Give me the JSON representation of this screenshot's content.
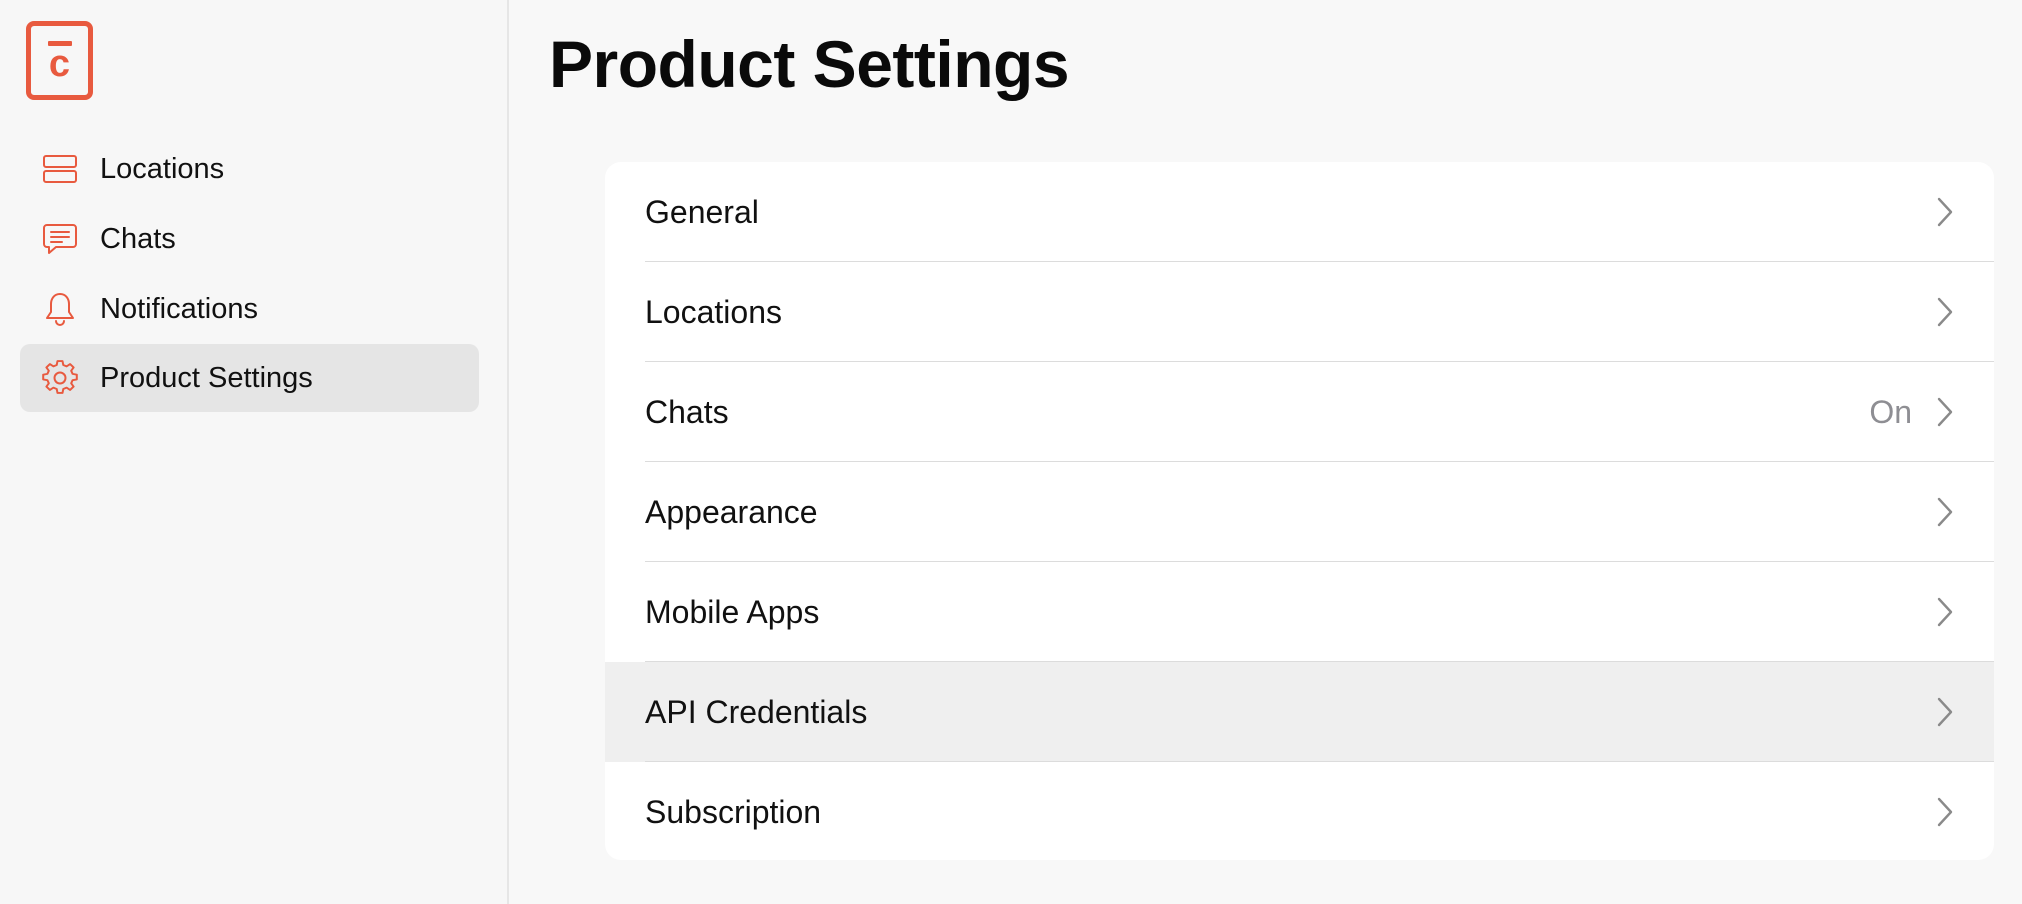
{
  "app": {
    "logo_letter": "c"
  },
  "sidebar": {
    "items": [
      {
        "label": "Locations",
        "icon": "locations-icon"
      },
      {
        "label": "Chats",
        "icon": "chat-bubble-icon"
      },
      {
        "label": "Notifications",
        "icon": "bell-icon"
      },
      {
        "label": "Product Settings",
        "icon": "gear-icon",
        "active": true
      }
    ]
  },
  "main": {
    "title": "Product Settings",
    "settings": [
      {
        "label": "General",
        "value": ""
      },
      {
        "label": "Locations",
        "value": ""
      },
      {
        "label": "Chats",
        "value": "On"
      },
      {
        "label": "Appearance",
        "value": ""
      },
      {
        "label": "Mobile Apps",
        "value": ""
      },
      {
        "label": "API Credentials",
        "value": "",
        "highlighted": true
      },
      {
        "label": "Subscription",
        "value": ""
      }
    ]
  },
  "colors": {
    "accent": "#e85a3f",
    "active_bg": "#e5e5e5",
    "highlight_row_bg": "#efefef",
    "secondary_text": "#8e8e93",
    "chevron": "#8a8a8a"
  }
}
